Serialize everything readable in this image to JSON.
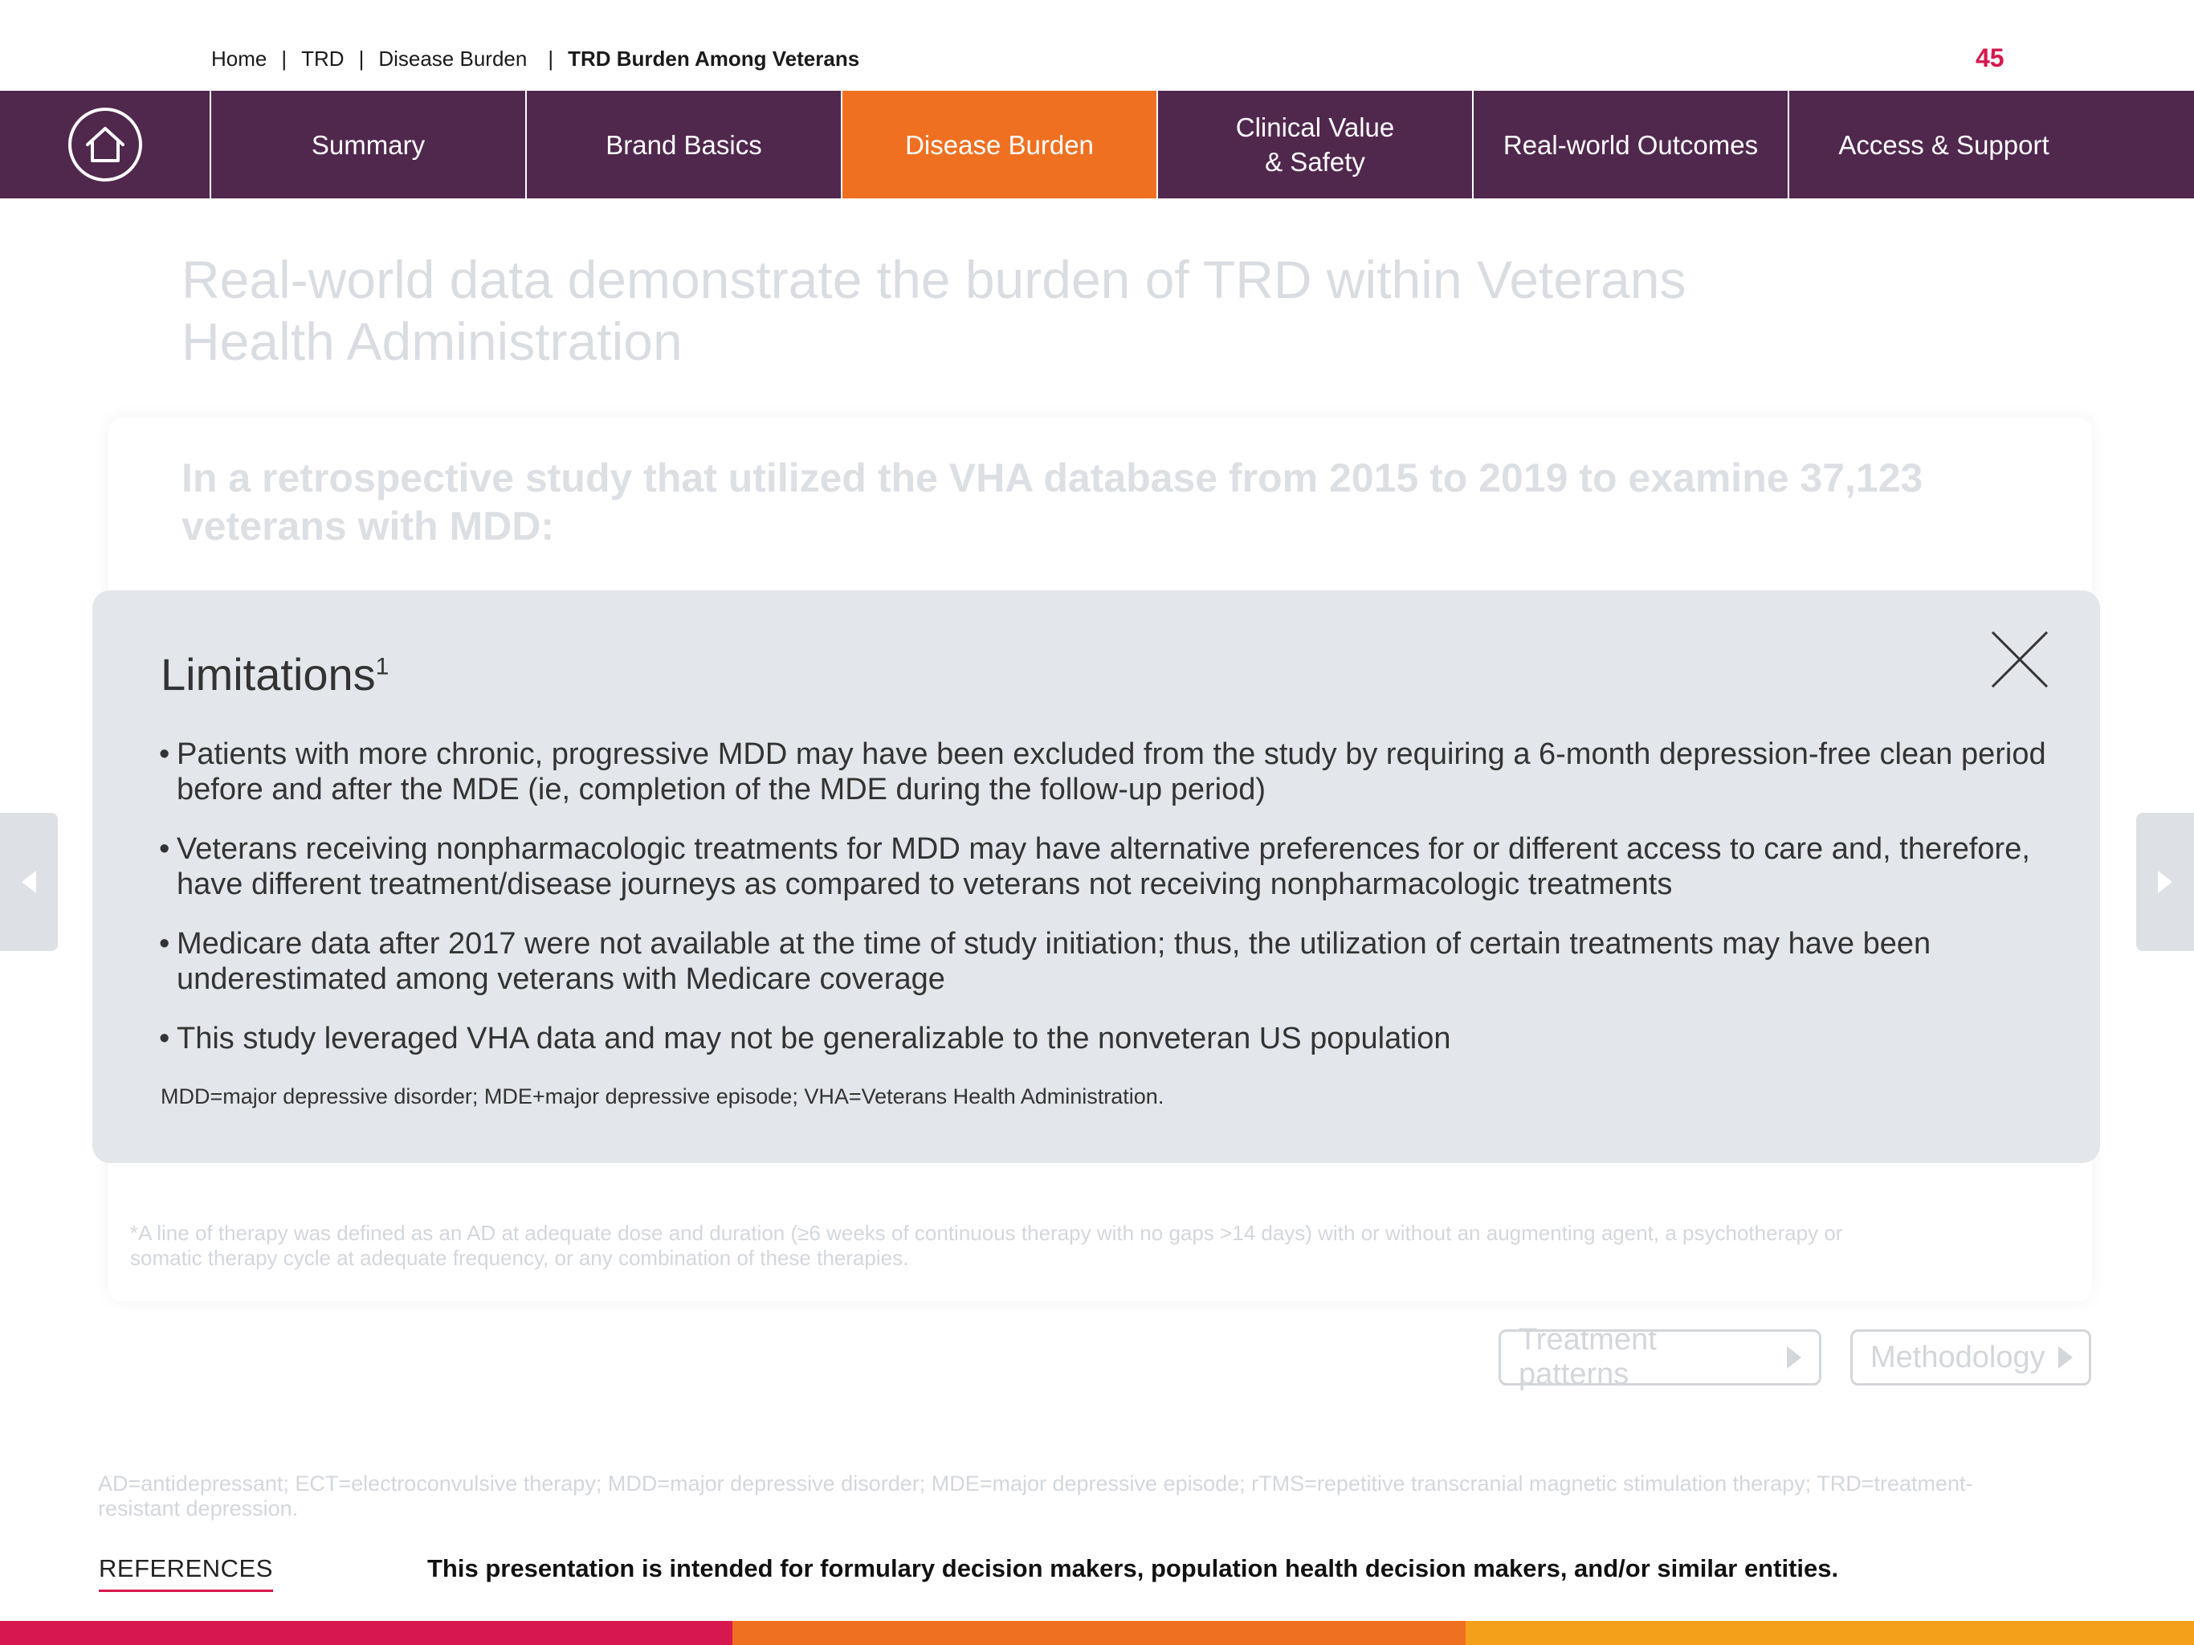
{
  "breadcrumb": {
    "home": "Home",
    "trd": "TRD",
    "disease_burden": "Disease Burden",
    "current": "TRD Burden Among Veterans",
    "sep": "|"
  },
  "page_number": "45",
  "nav": {
    "home_icon": "home-icon",
    "tabs": [
      {
        "label": "Summary",
        "active": false
      },
      {
        "label": "Brand Basics",
        "active": false
      },
      {
        "label": "Disease Burden",
        "active": true
      },
      {
        "label": "Clinical Value\n& Safety",
        "active": false
      },
      {
        "label": "Real-world Outcomes",
        "active": false
      },
      {
        "label": "Access & Support",
        "active": false
      }
    ]
  },
  "background": {
    "title": "Real-world data demonstrate the burden of TRD within Veterans Health Administration",
    "study_intro": "In a retrospective study that utilized the VHA database from 2015 to 2019 to examine 37,123 veterans with MDD:",
    "footnote": "*A line of therapy was defined as an AD at adequate dose and duration (≥6 weeks of continuous therapy with no gaps >14 days) with or without an augmenting agent, a psychotherapy or\n somatic therapy cycle at adequate frequency, or any combination of these therapies.",
    "btn_treatment": "Treatment patterns",
    "btn_methodology": "Methodology",
    "abbreviations": "AD=antidepressant; ECT=electroconvulsive therapy; MDD=major depressive disorder; MDE=major depressive episode; rTMS=repetitive transcranial magnetic stimulation therapy; TRD=treatment-resistant depression."
  },
  "modal": {
    "title": "Limitations",
    "title_sup": "1",
    "bullets": [
      "Patients with more chronic, progressive MDD may have been excluded from the study by requiring a 6-month depression-free clean period before and after the MDE (ie, completion of the MDE during the follow-up period)",
      "Veterans receiving nonpharmacologic treatments for MDD may have alternative preferences for or different access to care and, therefore, have different treatment/disease journeys as compared to veterans not receiving nonpharmacologic treatments",
      "Medicare data after 2017 were not available at the time of study initiation; thus, the utilization of certain treatments may have been underestimated among veterans with Medicare coverage",
      "This study leveraged VHA data and may not be generalizable to the nonveteran US population"
    ],
    "abbreviations": "MDD=major depressive disorder; MDE+major depressive episode; VHA=Veterans Health Administration."
  },
  "footer": {
    "references": "REFERENCES",
    "disclaimer": "This presentation is intended for formulary decision makers, population health decision makers, and/or similar entities."
  },
  "colors": {
    "nav_bg": "#50284e",
    "nav_active": "#f07022",
    "accent_red": "#d6184e",
    "bar_orange": "#f07022",
    "bar_yellow": "#f5a01a"
  }
}
